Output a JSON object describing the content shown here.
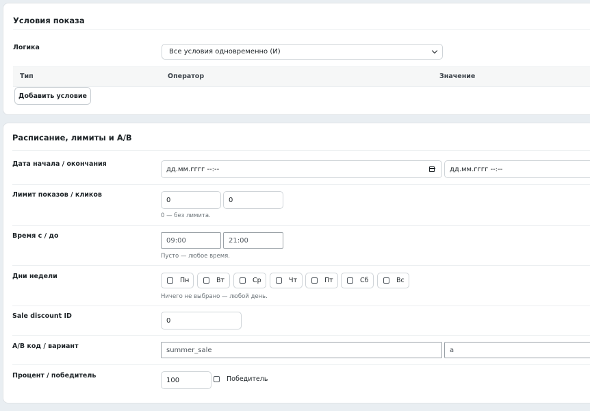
{
  "conditions": {
    "title": "Условия показа",
    "logic_label": "Логика",
    "logic_value": "Все условия одновременно (И)",
    "columns": [
      "Тип",
      "Оператор",
      "Значение"
    ],
    "add_button": "Добавить условие"
  },
  "schedule": {
    "title": "Расписание, лимиты и A/B",
    "date_label": "Дата начала / окончания",
    "date_start_placeholder": "дд.мм.гггг --:--",
    "date_end_placeholder": "дд.мм.гггг --:--",
    "limit_label": "Лимит показов / кликов",
    "limit_impressions": "0",
    "limit_clicks": "0",
    "limit_hint": "0 — без лимита.",
    "time_label": "Время с / до",
    "time_from_placeholder": "09:00",
    "time_to_placeholder": "21:00",
    "time_hint": "Пусто — любое время.",
    "days_label": "Дни недели",
    "days": [
      "Пн",
      "Вт",
      "Ср",
      "Чт",
      "Пт",
      "Сб",
      "Вс"
    ],
    "days_hint": "Ничего не выбрано — любой день.",
    "sale_label": "Sale discount ID",
    "sale_value": "0",
    "ab_label": "A/B код / вариант",
    "ab_code_placeholder": "summer_sale",
    "ab_variant_placeholder": "a",
    "percent_label": "Процент / победитель",
    "percent_value": "100",
    "winner_label": "Победитель"
  }
}
